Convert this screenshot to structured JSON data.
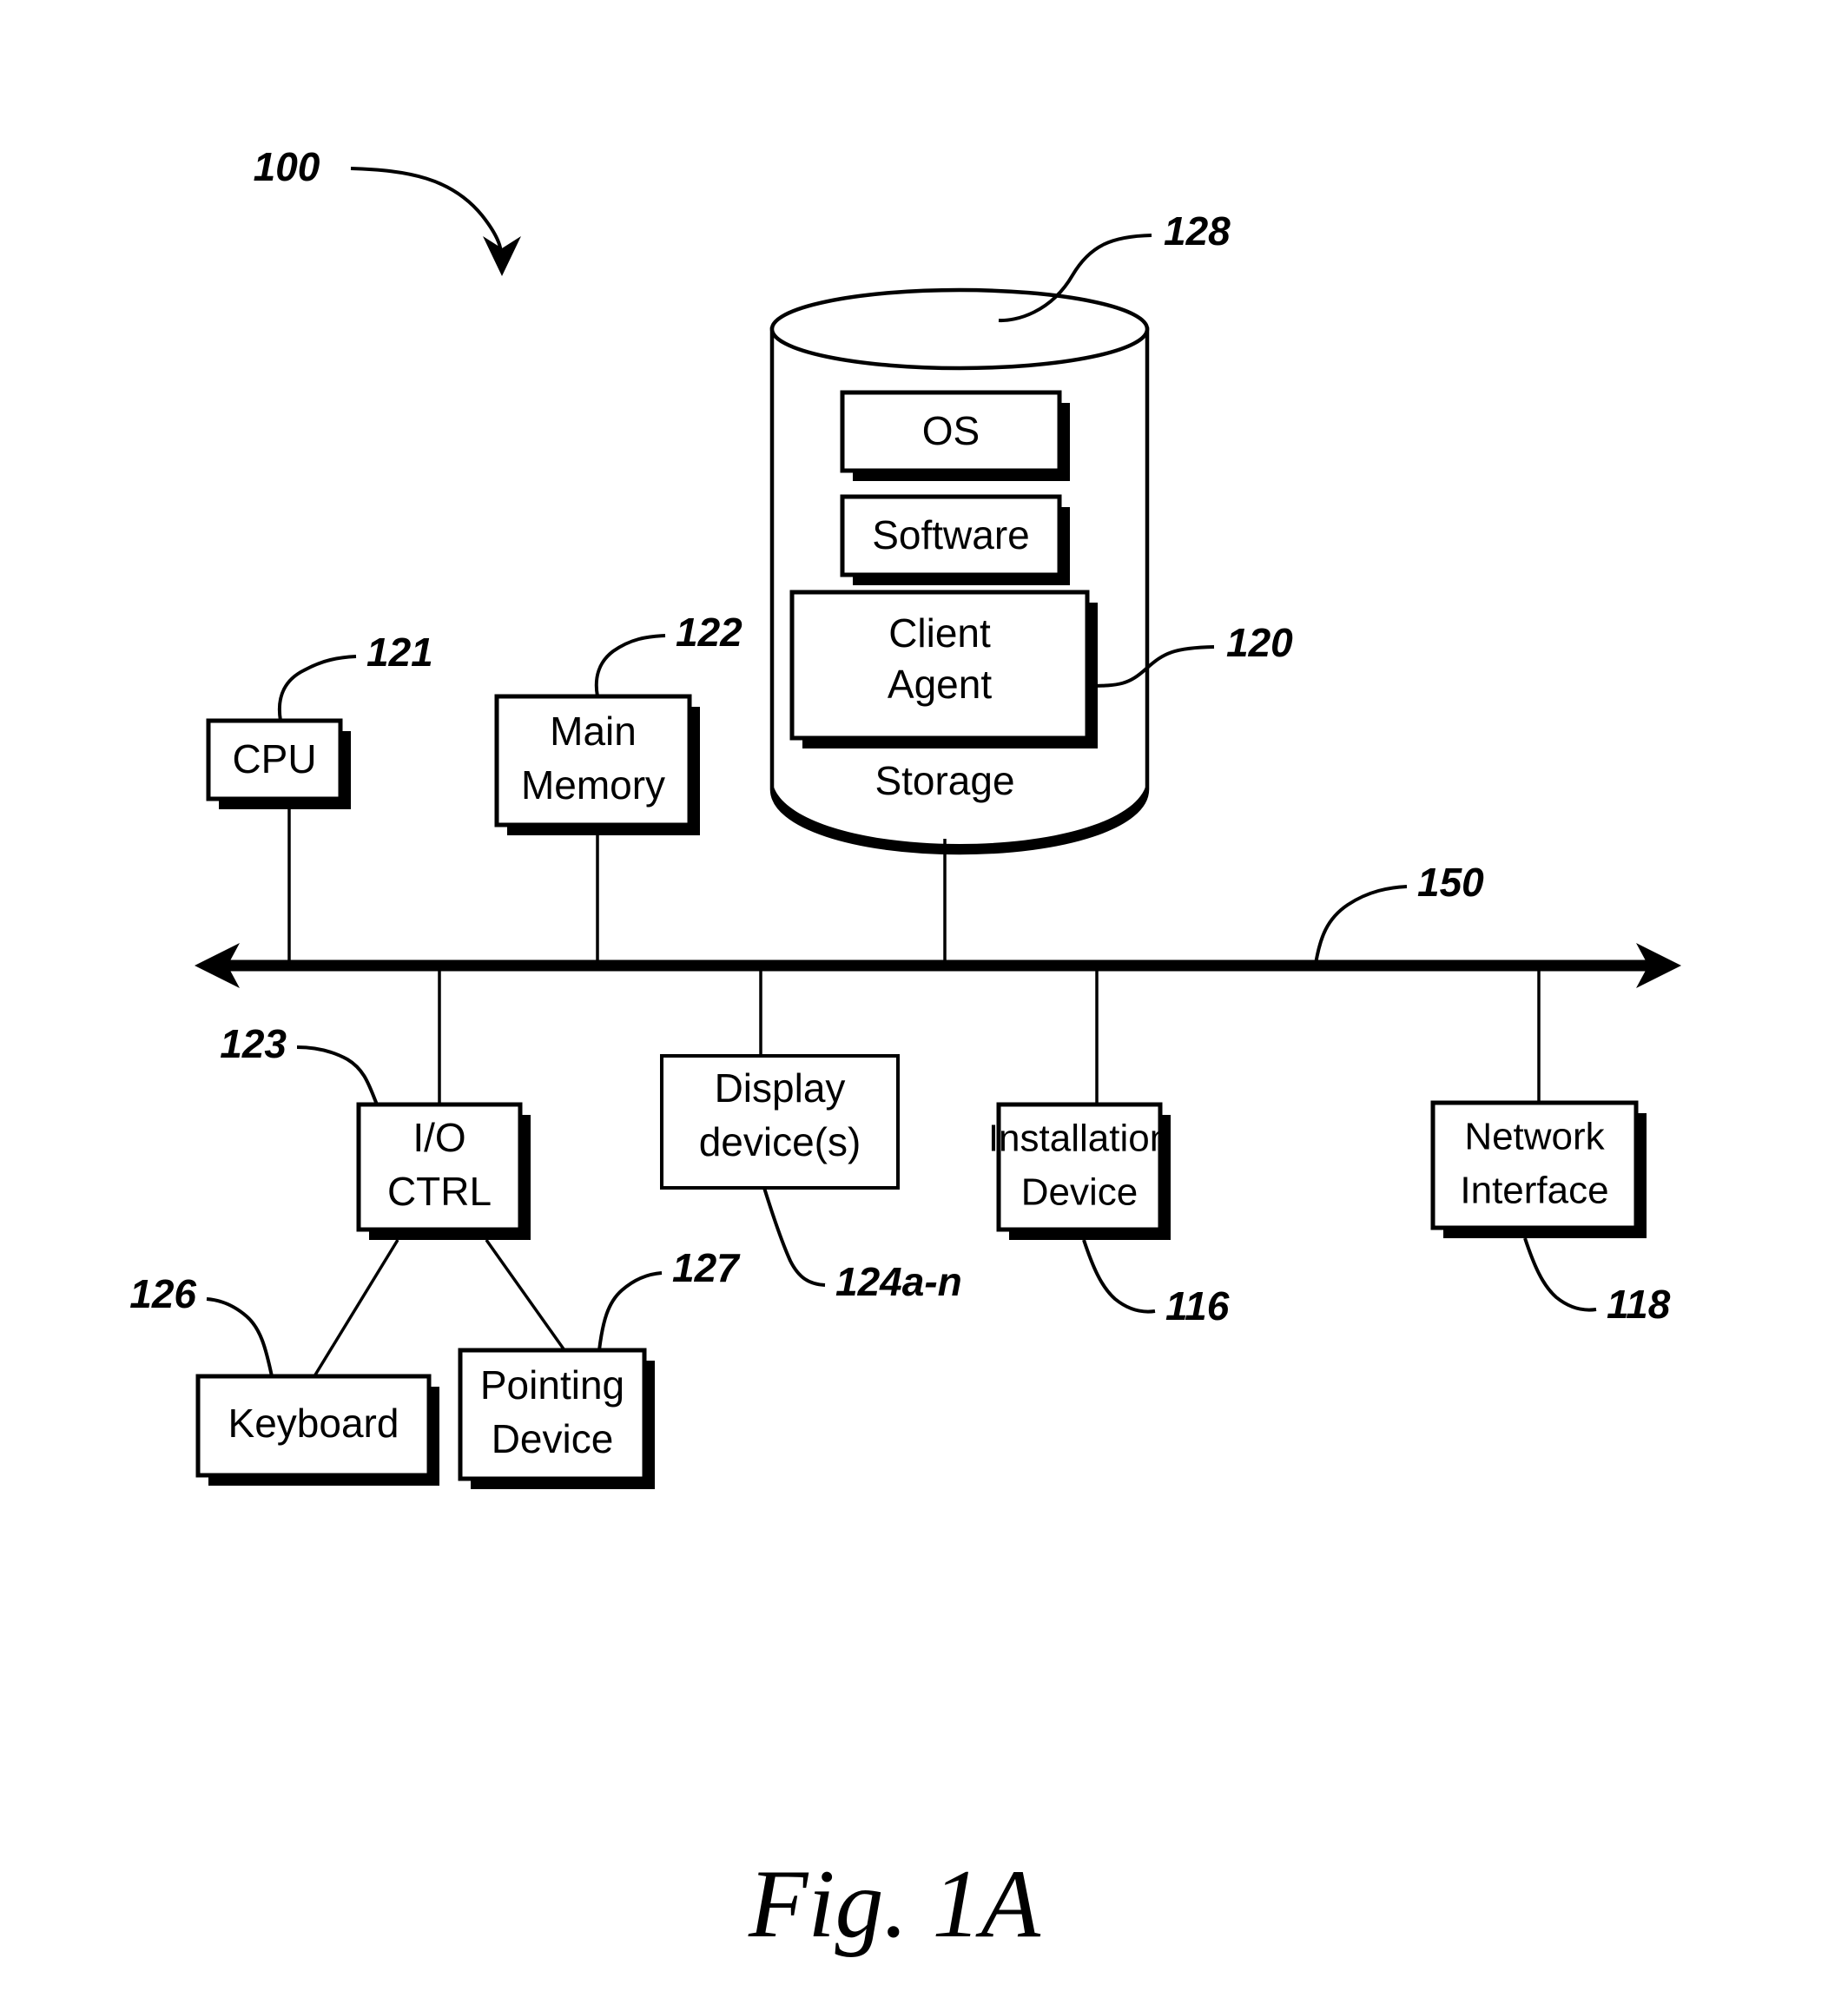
{
  "figure": {
    "caption": "Fig. 1A",
    "system_ref": "100"
  },
  "storage": {
    "label": "Storage",
    "ref": "128",
    "items": [
      {
        "label": "OS",
        "ref": ""
      },
      {
        "label": "Software",
        "ref": ""
      },
      {
        "label": "Client\nAgent",
        "line1": "Client",
        "line2": "Agent",
        "ref": "120"
      }
    ]
  },
  "bus": {
    "label": "",
    "ref": "150"
  },
  "components": [
    {
      "name": "cpu",
      "line1": "CPU",
      "line2": "",
      "ref": "121"
    },
    {
      "name": "main-memory",
      "line1": "Main",
      "line2": "Memory",
      "ref": "122"
    },
    {
      "name": "io-ctrl",
      "line1": "I/O",
      "line2": "CTRL",
      "ref": "123"
    },
    {
      "name": "display-devices",
      "line1": "Display",
      "line2": "device(s)",
      "ref": "124a-n"
    },
    {
      "name": "installation-device",
      "line1": "Installation",
      "line2": "Device",
      "ref": "116"
    },
    {
      "name": "network-interface",
      "line1": "Network",
      "line2": "Interface",
      "ref": "118"
    },
    {
      "name": "keyboard",
      "line1": "Keyboard",
      "line2": "",
      "ref": "126"
    },
    {
      "name": "pointing-device",
      "line1": "Pointing",
      "line2": "Device",
      "ref": "127"
    }
  ],
  "colors": {
    "ink": "#000000",
    "paper": "#ffffff"
  }
}
